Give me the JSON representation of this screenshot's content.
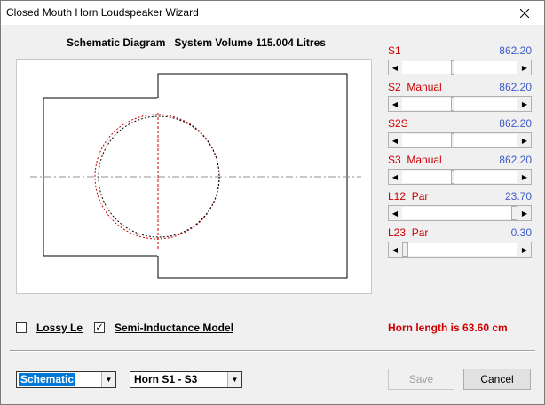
{
  "window": {
    "title": "Closed Mouth Horn Loudspeaker Wizard",
    "close_glyph": "close-icon"
  },
  "diagram": {
    "title": "Schematic Diagram   System Volume 115.004 Litres"
  },
  "params": [
    {
      "label": "S1",
      "value": "862.20",
      "thumb_fraction": 0.45
    },
    {
      "label": "S2  Manual",
      "value": "862.20",
      "thumb_fraction": 0.45
    },
    {
      "label": "S2S",
      "value": "862.20",
      "thumb_fraction": 0.45
    },
    {
      "label": "S3  Manual",
      "value": "862.20",
      "thumb_fraction": 0.45
    },
    {
      "label": "L12  Par",
      "value": "23.70",
      "thumb_fraction": 1.0
    },
    {
      "label": "L23  Par",
      "value": "0.30",
      "thumb_fraction": 0.0
    }
  ],
  "checkboxes": {
    "lossy": {
      "label": "Lossy Le",
      "checked": false
    },
    "semi": {
      "label": "Semi-Inductance Model",
      "checked": true,
      "check_glyph": "✓"
    }
  },
  "horn_length": "Horn length is 63.60 cm",
  "view_combo": {
    "value": "Schematic"
  },
  "horn_combo": {
    "value": "Horn S1 - S3"
  },
  "buttons": {
    "save": "Save",
    "cancel": "Cancel"
  },
  "colors": {
    "label_red": "#cc0000",
    "value_blue": "#3c5ac8",
    "selection": "#0078d7"
  }
}
